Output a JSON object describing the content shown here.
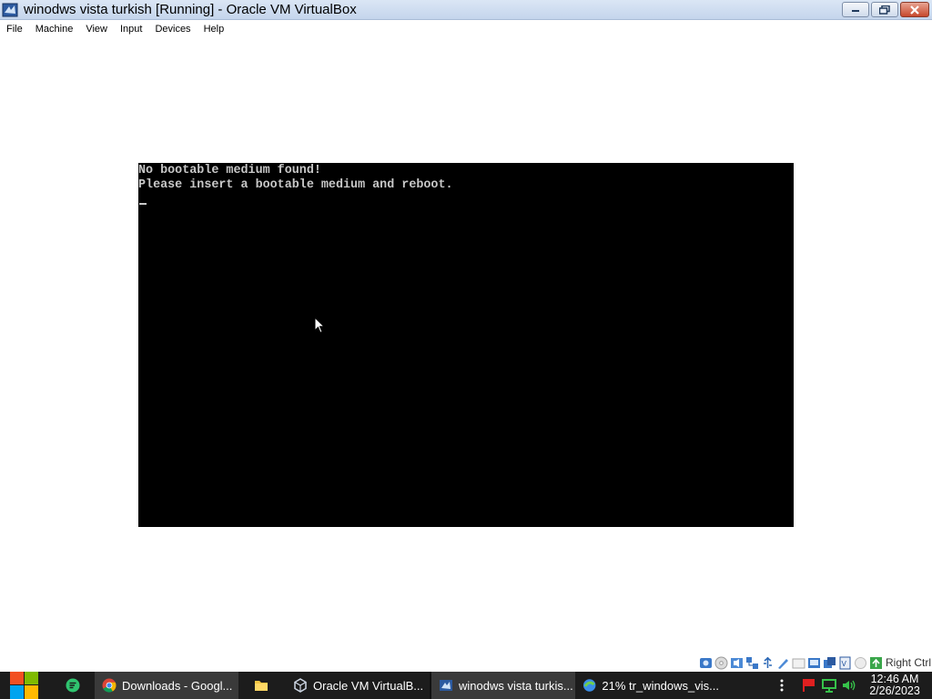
{
  "window": {
    "title": "winodws vista turkish [Running] - Oracle VM VirtualBox"
  },
  "menu": {
    "items": [
      {
        "label": "File"
      },
      {
        "label": "Machine"
      },
      {
        "label": "View"
      },
      {
        "label": "Input"
      },
      {
        "label": "Devices"
      },
      {
        "label": "Help"
      }
    ]
  },
  "vm_console": {
    "line1": "No bootable medium found!",
    "line2": "Please insert a bootable medium and reboot."
  },
  "status_bar": {
    "icons": [
      "hard-disk-icon",
      "optical-drive-icon",
      "audio-icon",
      "network-icon",
      "usb-icon",
      "shared-folders-icon",
      "display-icon",
      "video-capture-icon",
      "virtualization-icon",
      "mouse-integration-icon",
      "keyboard-capture-icon"
    ],
    "host_key": "Right Ctrl"
  },
  "taskbar": {
    "tasks": [
      {
        "label": "Downloads - Googl...",
        "icon": "chrome-icon"
      },
      {
        "label": "Oracle VM VirtualB...",
        "icon": "virtualbox-icon"
      },
      {
        "label": "winodws vista turkis...",
        "icon": "vm-window-icon"
      },
      {
        "label": "21% tr_windows_vis...",
        "icon": "download-progress-icon"
      }
    ],
    "clock_time": "12:46 AM",
    "clock_date": "2/26/2023"
  },
  "colors": {
    "taskbar_bg": "#1c1c1c",
    "titlebar_bg": "#c4d5ec",
    "console_text": "#c8c8c8"
  }
}
